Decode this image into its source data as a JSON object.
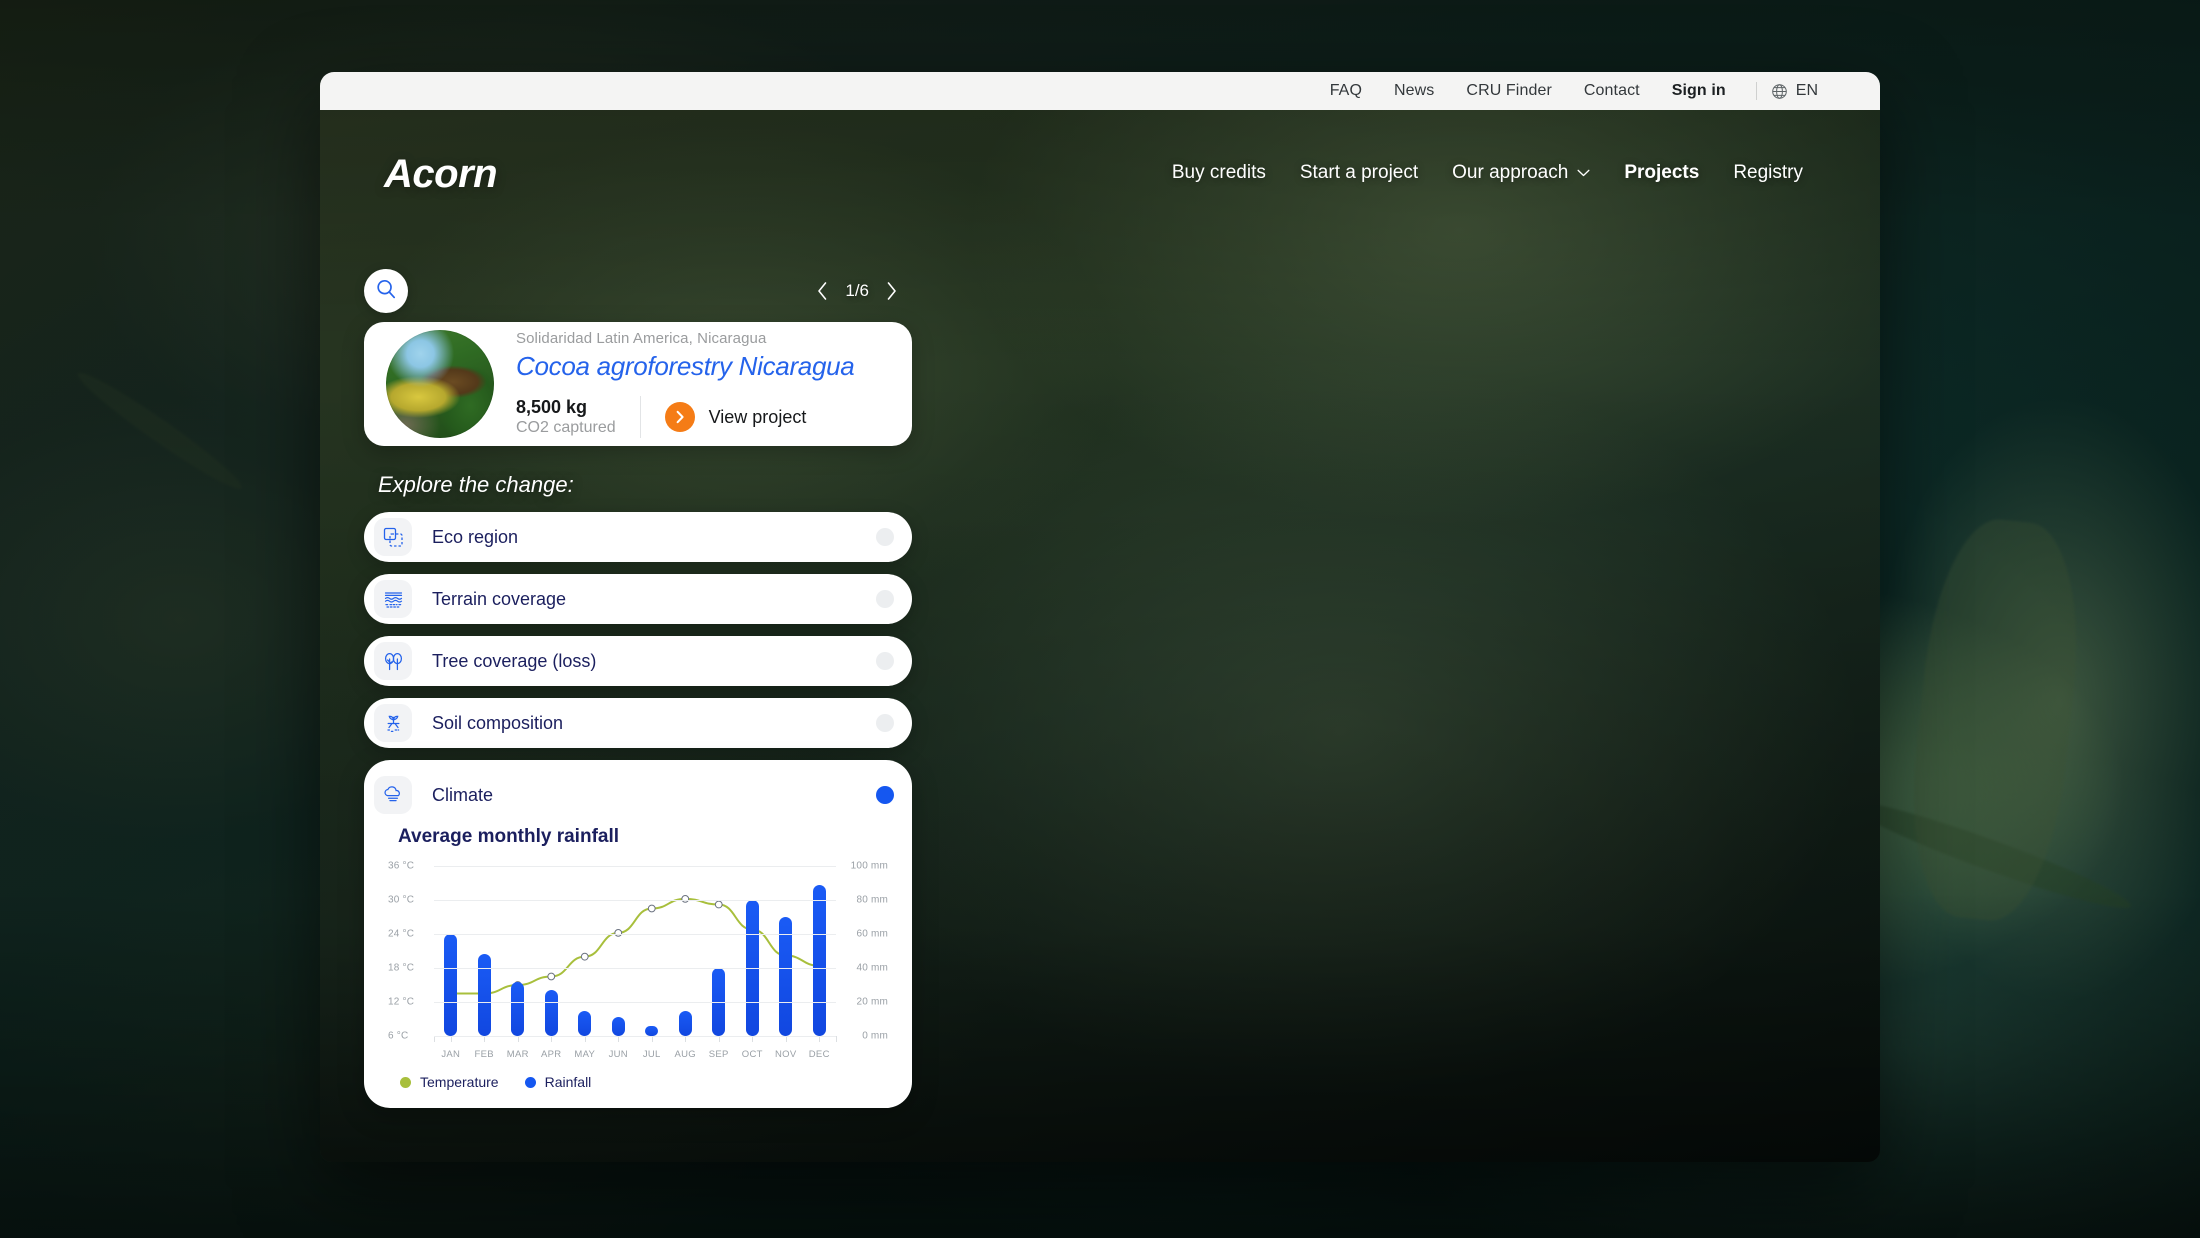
{
  "browser_bar": {
    "links": [
      {
        "label": "FAQ",
        "bold": false
      },
      {
        "label": "News",
        "bold": false
      },
      {
        "label": "CRU Finder",
        "bold": false
      },
      {
        "label": "Contact",
        "bold": false
      },
      {
        "label": "Sign in",
        "bold": true
      }
    ],
    "language": "EN",
    "language_icon": "globe-icon"
  },
  "header": {
    "logo": "Acorn",
    "nav": [
      {
        "label": "Buy credits",
        "active": false,
        "caret": false
      },
      {
        "label": "Start a project",
        "active": false,
        "caret": false
      },
      {
        "label": "Our approach",
        "active": false,
        "caret": true
      },
      {
        "label": "Projects",
        "active": true,
        "caret": false
      },
      {
        "label": "Registry",
        "active": false,
        "caret": false
      }
    ]
  },
  "panel": {
    "search_icon": "search-icon",
    "pagination": {
      "current": 1,
      "total": 6,
      "text": "1/6",
      "prev_icon": "chevron-left-icon",
      "next_icon": "chevron-right-icon"
    },
    "project": {
      "organization": "Solidaridad Latin America, Nicaragua",
      "title": "Cocoa agroforestry Nicaragua",
      "co2_value": "8,500 kg",
      "co2_label": "CO2 captured",
      "view_label": "View project",
      "view_icon": "chevron-right-circle-icon",
      "thumbnail_alt": "cocoa-pods-photo"
    },
    "explore_heading": "Explore the change:",
    "layers": [
      {
        "label": "Eco region",
        "icon": "eco-region-icon",
        "selected": false
      },
      {
        "label": "Terrain coverage",
        "icon": "terrain-coverage-icon",
        "selected": false
      },
      {
        "label": "Tree coverage (loss)",
        "icon": "tree-coverage-icon",
        "selected": false
      },
      {
        "label": "Soil composition",
        "icon": "soil-composition-icon",
        "selected": false
      },
      {
        "label": "Climate",
        "icon": "climate-cloud-icon",
        "selected": true
      }
    ],
    "climate": {
      "label": "Climate",
      "chart_title": "Average monthly rainfall"
    }
  },
  "colors": {
    "accent_blue": "#1557f0",
    "link_blue": "#2563eb",
    "orange": "#f57c16",
    "temp_green": "#a8bf3c",
    "navy_text": "#1b1f5e",
    "muted": "#9aa0a6"
  },
  "chart_data": {
    "type": "bar",
    "title": "Average monthly rainfall",
    "categories": [
      "JAN",
      "FEB",
      "MAR",
      "APR",
      "MAY",
      "JUN",
      "JUL",
      "AUG",
      "SEP",
      "OCT",
      "NOV",
      "DEC"
    ],
    "series": [
      {
        "name": "Rainfall",
        "unit": "mm",
        "axis": "right",
        "color": "#1147e0",
        "values": [
          60,
          48,
          32,
          27,
          15,
          11,
          6,
          15,
          40,
          80,
          70,
          89
        ]
      },
      {
        "name": "Temperature",
        "unit": "°C",
        "axis": "left",
        "color": "#a8bf3c",
        "values": [
          13.5,
          13.5,
          15.0,
          16.5,
          20.0,
          24.2,
          28.5,
          30.2,
          29.2,
          24.8,
          20.2,
          18.4
        ]
      }
    ],
    "left_axis": {
      "label": "Temperature",
      "unit": "°C",
      "ticks": [
        "36 °C",
        "30 °C",
        "24 °C",
        "18 °C",
        "12 °C",
        "6 °C"
      ],
      "min": 6,
      "max": 36
    },
    "right_axis": {
      "label": "Rainfall",
      "unit": "mm",
      "ticks": [
        "100 mm",
        "80 mm",
        "60 mm",
        "40 mm",
        "20 mm",
        "0 mm"
      ],
      "min": 0,
      "max": 100
    },
    "legend": [
      {
        "name": "Temperature",
        "color": "#a8bf3c"
      },
      {
        "name": "Rainfall",
        "color": "#1557f0"
      }
    ],
    "legend_position": "bottom-left",
    "grid": true
  }
}
